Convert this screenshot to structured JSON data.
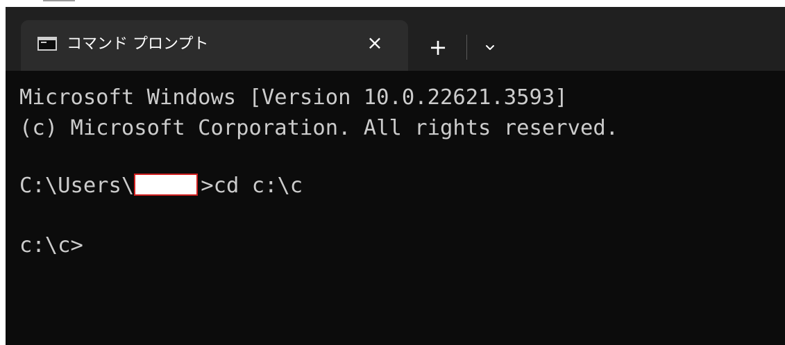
{
  "tab": {
    "title": "コマンド プロンプト",
    "icon": "cmd-icon",
    "close_label": "×"
  },
  "tabbar": {
    "new_tab_label": "+",
    "dropdown_icon": "chevron-down-icon"
  },
  "terminal": {
    "line1": "Microsoft Windows [Version 10.0.22621.3593]",
    "line2": "(c) Microsoft Corporation. All rights reserved.",
    "line3_prefix": "C:\\Users\\",
    "line3_suffix": ">cd c:\\c",
    "line4": "c:\\c>"
  },
  "colors": {
    "terminal_bg": "#0c0c0c",
    "terminal_text": "#cccccc",
    "tab_active": "#2c2c2c",
    "tabbar_bg": "#202020",
    "redaction_border": "#d02020"
  }
}
